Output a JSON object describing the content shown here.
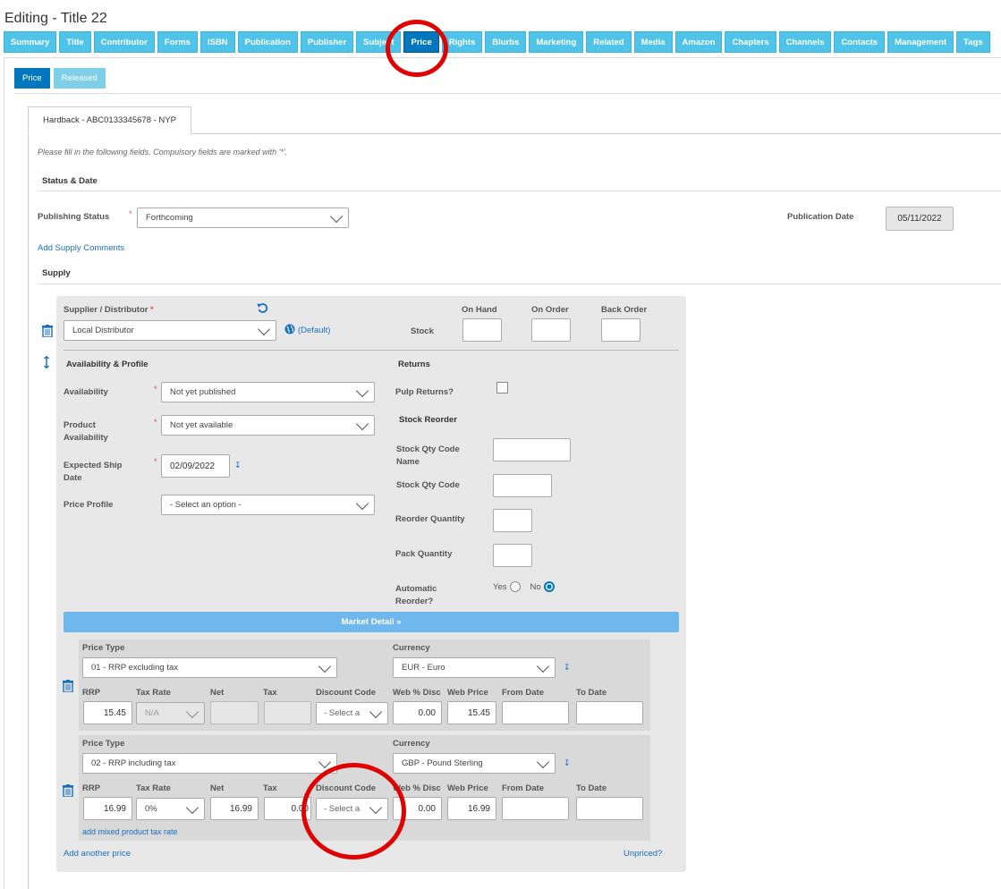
{
  "page_title": "Editing - Title 22",
  "tabs": [
    "Summary",
    "Title",
    "Contributor",
    "Forms",
    "ISBN",
    "Publication",
    "Publisher",
    "Subject",
    "Price",
    "Rights",
    "Blurbs",
    "Marketing",
    "Related",
    "Media",
    "Amazon",
    "Chapters",
    "Channels",
    "Contacts",
    "Management",
    "Tags"
  ],
  "active_tab": "Price",
  "subtabs": {
    "price": "Price",
    "released": "Released"
  },
  "product_tab": "Hardback - ABC0133345678 - NYP",
  "hint": "Please fill in the following fields. Compulsory fields are marked with '*'.",
  "status_date": {
    "heading": "Status & Date",
    "publishing_status_label": "Publishing Status",
    "publishing_status_value": "Forthcoming",
    "publication_date_label": "Publication Date",
    "publication_date_value": "05/11/2022",
    "add_supply_comments": "Add Supply Comments"
  },
  "supply": {
    "heading": "Supply",
    "supplier_label": "Supplier / Distributor",
    "supplier_value": "Local Distributor",
    "default_link": "(Default)",
    "stock_label": "Stock",
    "on_hand": "On Hand",
    "on_order": "On Order",
    "back_order": "Back Order",
    "availability_heading": "Availability & Profile",
    "availability_label": "Availability",
    "availability_value": "Not yet published",
    "product_availability_label_1": "Product",
    "product_availability_label_2": "Availability",
    "product_availability_value": "Not yet available",
    "expected_ship_label_1": "Expected Ship",
    "expected_ship_label_2": "Date",
    "expected_ship_value": "02/09/2022",
    "price_profile_label": "Price Profile",
    "price_profile_value": "- Select an option -",
    "returns_heading": "Returns",
    "pulp_returns_label": "Pulp Returns?",
    "stock_reorder_heading": "Stock Reorder",
    "stock_qty_code_name_1": "Stock Qty Code",
    "stock_qty_code_name_2": "Name",
    "stock_qty_code": "Stock Qty Code",
    "reorder_quantity": "Reorder Quantity",
    "pack_quantity": "Pack Quantity",
    "automatic_reorder_1": "Automatic",
    "automatic_reorder_2": "Reorder?",
    "yes": "Yes",
    "no": "No",
    "automatic_reorder_value": "No"
  },
  "market_detail": "Market Detail",
  "col_headers": {
    "price_type": "Price Type",
    "currency": "Currency",
    "rrp": "RRP",
    "tax_rate": "Tax Rate",
    "net": "Net",
    "tax": "Tax",
    "discount_code": "Discount Code",
    "web_disc": "Web % Disc",
    "web_price": "Web Price",
    "from_date": "From Date",
    "to_date": "To Date"
  },
  "prices": [
    {
      "price_type": "01 - RRP excluding tax",
      "currency": "EUR - Euro",
      "rrp": "15.45",
      "tax_rate": "N/A",
      "net": "",
      "tax": "",
      "discount": "- Select a",
      "web_disc": "0.00",
      "web_price": "15.45",
      "from": "",
      "to": ""
    },
    {
      "price_type": "02 - RRP including tax",
      "currency": "GBP - Pound Sterling",
      "rrp": "16.99",
      "tax_rate": "0%",
      "net": "16.99",
      "tax": "0.00",
      "discount": "- Select a",
      "web_disc": "0.00",
      "web_price": "16.99",
      "from": "",
      "to": ""
    }
  ],
  "add_mixed_tax": "add mixed product tax rate",
  "add_another_price": "Add another price",
  "unpriced": "Unpriced?",
  "colors": {
    "tab": "#4fc3e8",
    "tab_active": "#0277bd",
    "annotation": "#e00000"
  }
}
